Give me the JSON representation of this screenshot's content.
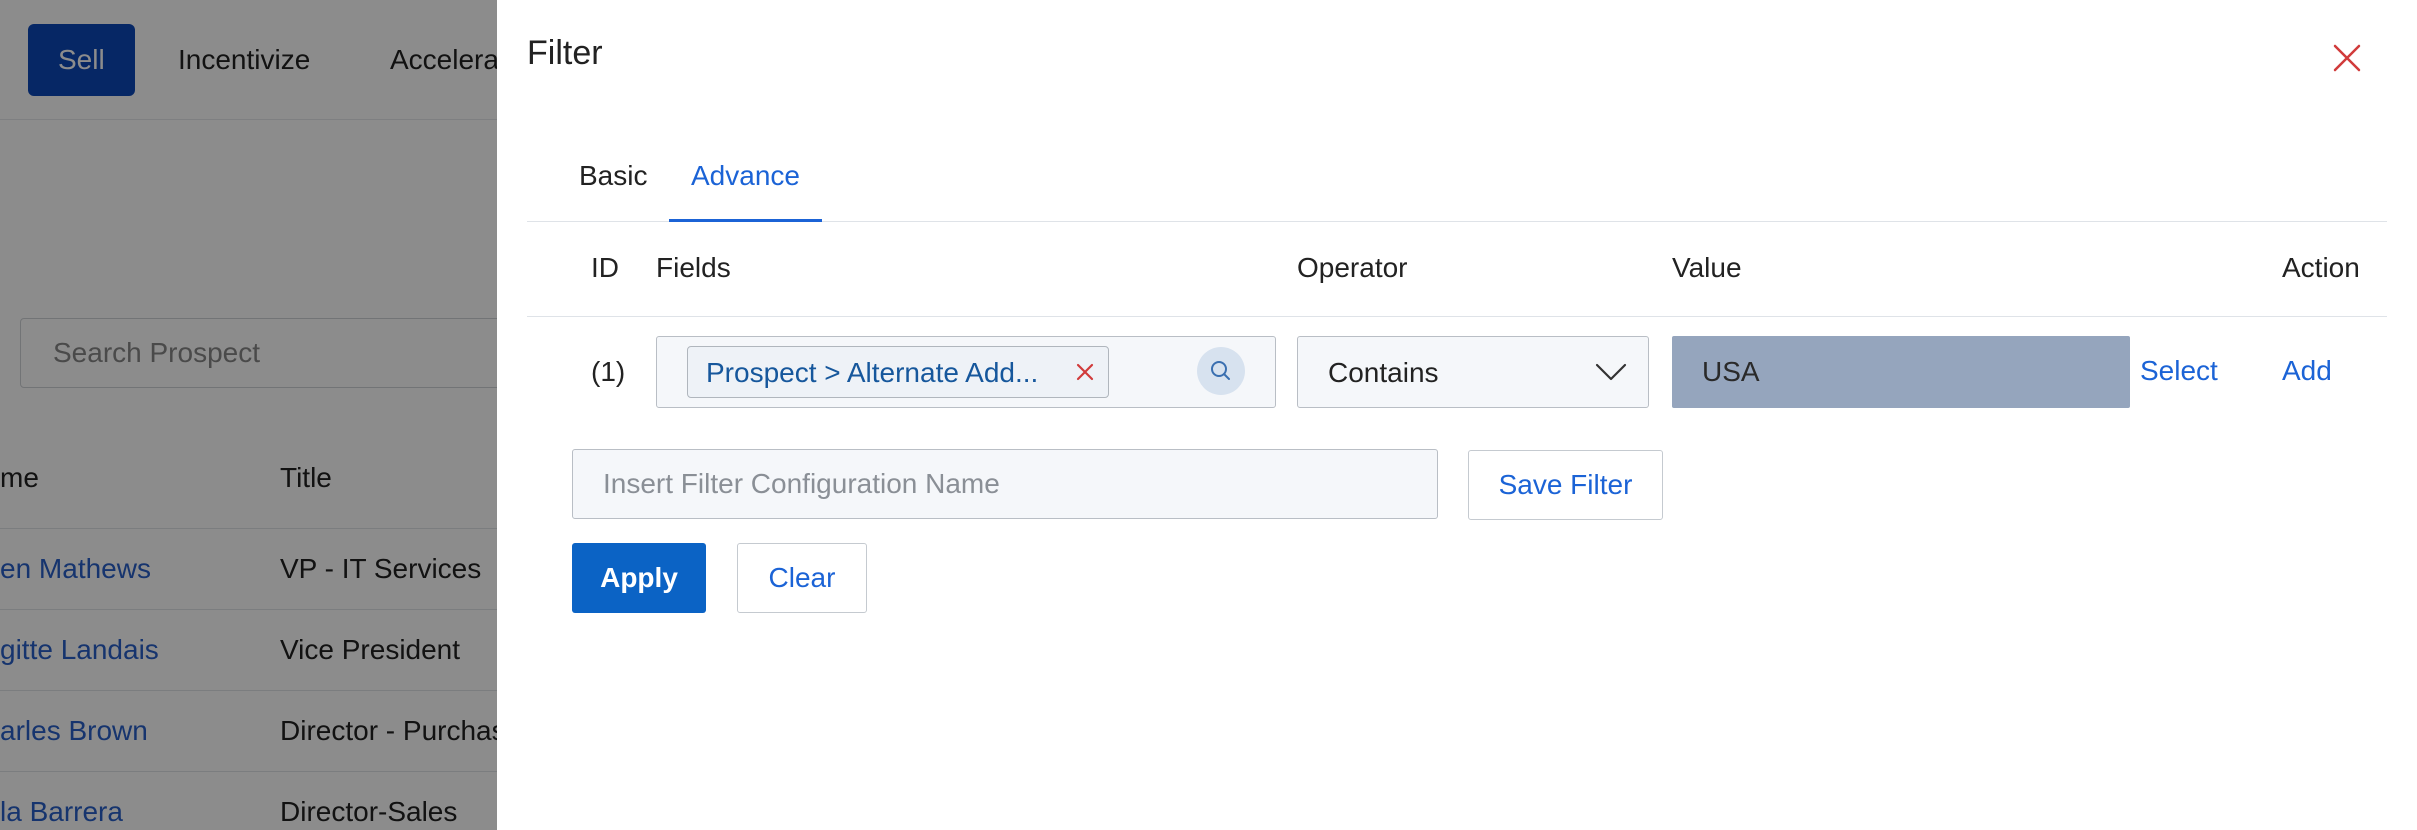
{
  "background": {
    "nav": {
      "sell": "Sell",
      "incentivize": "Incentivize",
      "accelerate": "Accelera"
    },
    "search_placeholder": "Search Prospect",
    "table": {
      "headers": {
        "name": "me",
        "title": "Title"
      },
      "rows": [
        {
          "name": "en Mathews",
          "title": "VP - IT Services"
        },
        {
          "name": "gitte Landais",
          "title": "Vice President"
        },
        {
          "name": "arles Brown",
          "title": "Director - Purchas"
        },
        {
          "name": "la Barrera",
          "title": "Director-Sales"
        }
      ]
    }
  },
  "drawer": {
    "title": "Filter",
    "tabs": [
      {
        "label": "Basic"
      },
      {
        "label": "Advance"
      }
    ],
    "columns": {
      "id": "ID",
      "fields": "Fields",
      "operator": "Operator",
      "value": "Value",
      "action": "Action"
    },
    "row": {
      "id": "(1)",
      "field_chip": "Prospect > Alternate Add...",
      "operator": "Contains",
      "value": "USA",
      "select_label": "Select",
      "add_label": "Add"
    },
    "config_placeholder": "Insert Filter Configuration Name",
    "save_filter_label": "Save Filter",
    "apply_label": "Apply",
    "clear_label": "Clear"
  },
  "icons": {
    "close": "close-icon",
    "chip_remove": "close-icon",
    "field_search": "search-icon",
    "operator_dropdown": "chevron-down-icon"
  },
  "colors": {
    "primary": "#0b63c5",
    "link": "#1b63d6",
    "nav_active": "#0b47b8",
    "value_fill": "#95a5bd",
    "close": "#d13b3b"
  }
}
